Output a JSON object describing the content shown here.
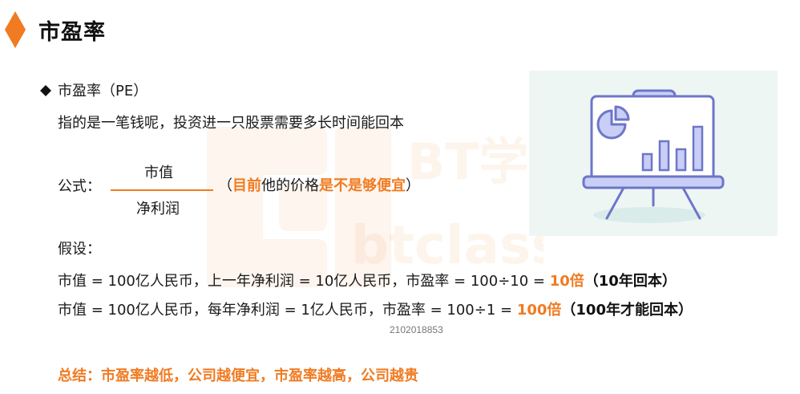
{
  "header": {
    "title": "市盈率"
  },
  "section": {
    "heading": "市盈率（PE）",
    "definition": "指的是一笔钱呢，投资进一只股票需要多长时间能回本"
  },
  "formula": {
    "label": "公式：",
    "numerator": "市值",
    "denominator": "净利润",
    "note_open": "（",
    "note_part1": "目前",
    "note_part2": "他的价格",
    "note_part3": "是不是够便宜",
    "note_close": "）"
  },
  "assumption": {
    "label": "假设：",
    "line1": {
      "text": "市值 = 100亿人民币，上一年净利润 = 10亿人民币，市盈率 = 100÷10 = ",
      "result": "10倍",
      "suffix": "（10年回本）"
    },
    "line2": {
      "text": "市值 = 100亿人民币，每年净利润 = 1亿人民币，市盈率 = 100÷1 = ",
      "result": "100倍",
      "suffix": "（100年才能回本）"
    }
  },
  "code": "2102018853",
  "summary": "总结：市盈率越低，公司越便宜，市盈率越高，公司越贵",
  "watermark": {
    "line1": "BT学院",
    "line2": "btclass"
  },
  "colors": {
    "accent": "#f07b22",
    "illustration_bg": "#eef6f4",
    "board_fill": "#c9cef6",
    "board_stroke": "#6d76c8"
  },
  "icons": {
    "title_marker": "orange-diamond-icon",
    "bullet": "black-diamond-bullet-icon",
    "illustration": "presentation-board-chart-icon"
  }
}
